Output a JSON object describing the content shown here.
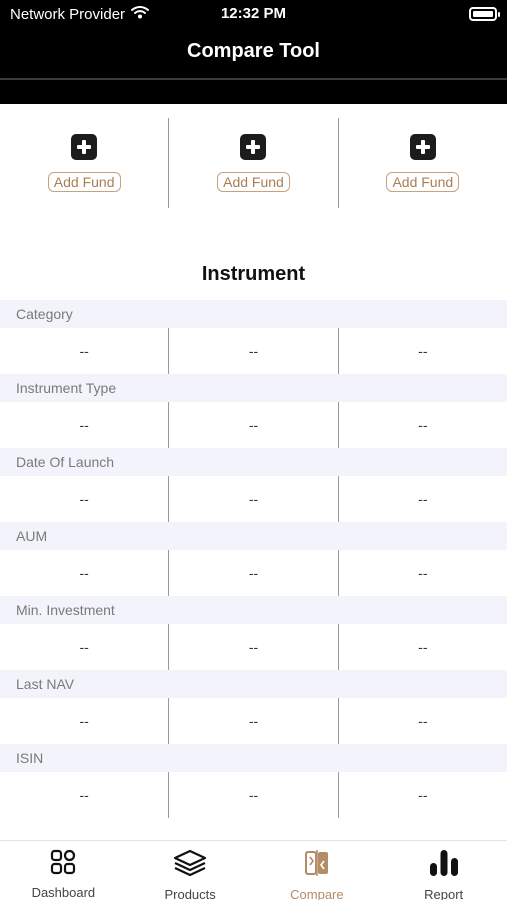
{
  "status_bar": {
    "carrier": "Network Provider",
    "time": "12:32 PM"
  },
  "nav": {
    "title": "Compare Tool"
  },
  "fund_slots": [
    {
      "button_label": "Add Fund"
    },
    {
      "button_label": "Add Fund"
    },
    {
      "button_label": "Add Fund"
    }
  ],
  "section": {
    "title": "Instrument"
  },
  "rows": [
    {
      "label": "Category",
      "values": [
        "--",
        "--",
        "--"
      ]
    },
    {
      "label": "Instrument Type",
      "values": [
        "--",
        "--",
        "--"
      ]
    },
    {
      "label": "Date Of Launch",
      "values": [
        "--",
        "--",
        "--"
      ]
    },
    {
      "label": "AUM",
      "values": [
        "--",
        "--",
        "--"
      ]
    },
    {
      "label": "Min. Investment",
      "values": [
        "--",
        "--",
        "--"
      ]
    },
    {
      "label": "Last NAV",
      "values": [
        "--",
        "--",
        "--"
      ]
    },
    {
      "label": "ISIN",
      "values": [
        "--",
        "--",
        "--"
      ]
    }
  ],
  "tabs": [
    {
      "label": "Dashboard",
      "icon": "dashboard-grid-icon",
      "active": false
    },
    {
      "label": "Products",
      "icon": "layers-stack-icon",
      "active": false
    },
    {
      "label": "Compare",
      "icon": "compare-icon",
      "active": true
    },
    {
      "label": "Report",
      "icon": "bar-chart-icon",
      "active": false
    }
  ],
  "colors": {
    "accent": "#b48c67",
    "header_bg": "#000000",
    "row_label_bg": "#f2f3fb"
  }
}
